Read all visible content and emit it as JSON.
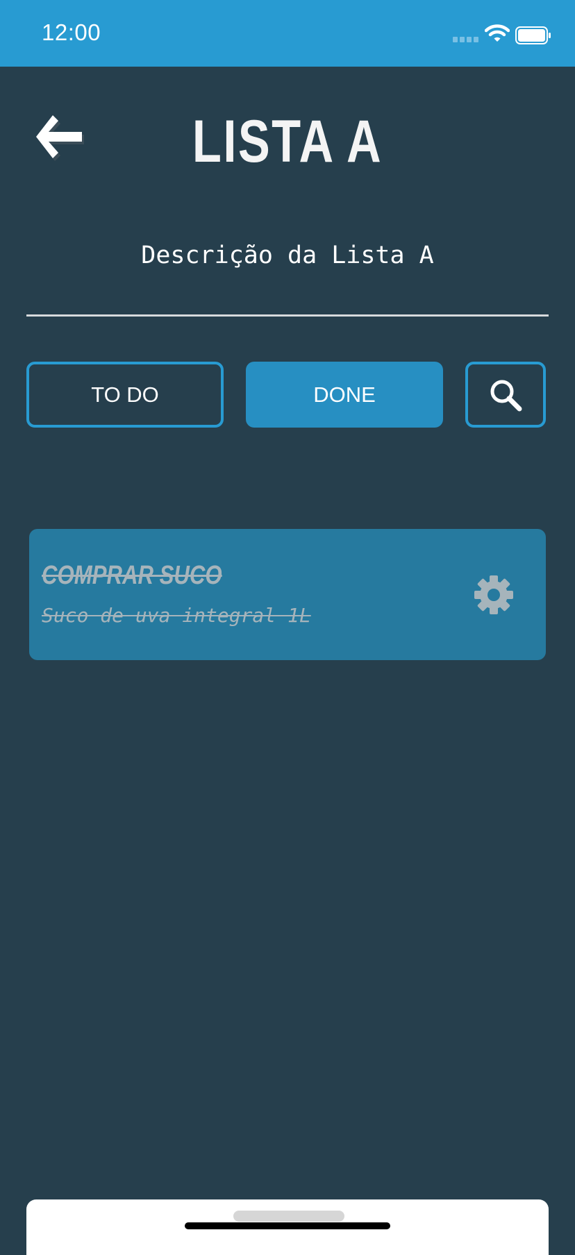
{
  "status_bar": {
    "time": "12:00",
    "background": "#289bd2",
    "icons": [
      "signal-icon",
      "wifi-icon",
      "battery-icon"
    ]
  },
  "header": {
    "back_icon": "arrow-left-icon",
    "title": "LISTA A"
  },
  "list": {
    "description": "Descrição da Lista A"
  },
  "tabs": [
    {
      "label": "TO DO",
      "selected": false
    },
    {
      "label": "DONE",
      "selected": true
    }
  ],
  "search": {
    "icon": "search-icon"
  },
  "tasks": [
    {
      "title": "COMPRAR SUCO",
      "description": "Suco de uva integral 1L",
      "done": true,
      "action_icon": "gear-icon"
    }
  ],
  "colors": {
    "background": "#263f4d",
    "accent": "#289bd2",
    "tab_selected": "#278fc2",
    "card": "#267a9f",
    "done_text": "#a6b4bb"
  }
}
